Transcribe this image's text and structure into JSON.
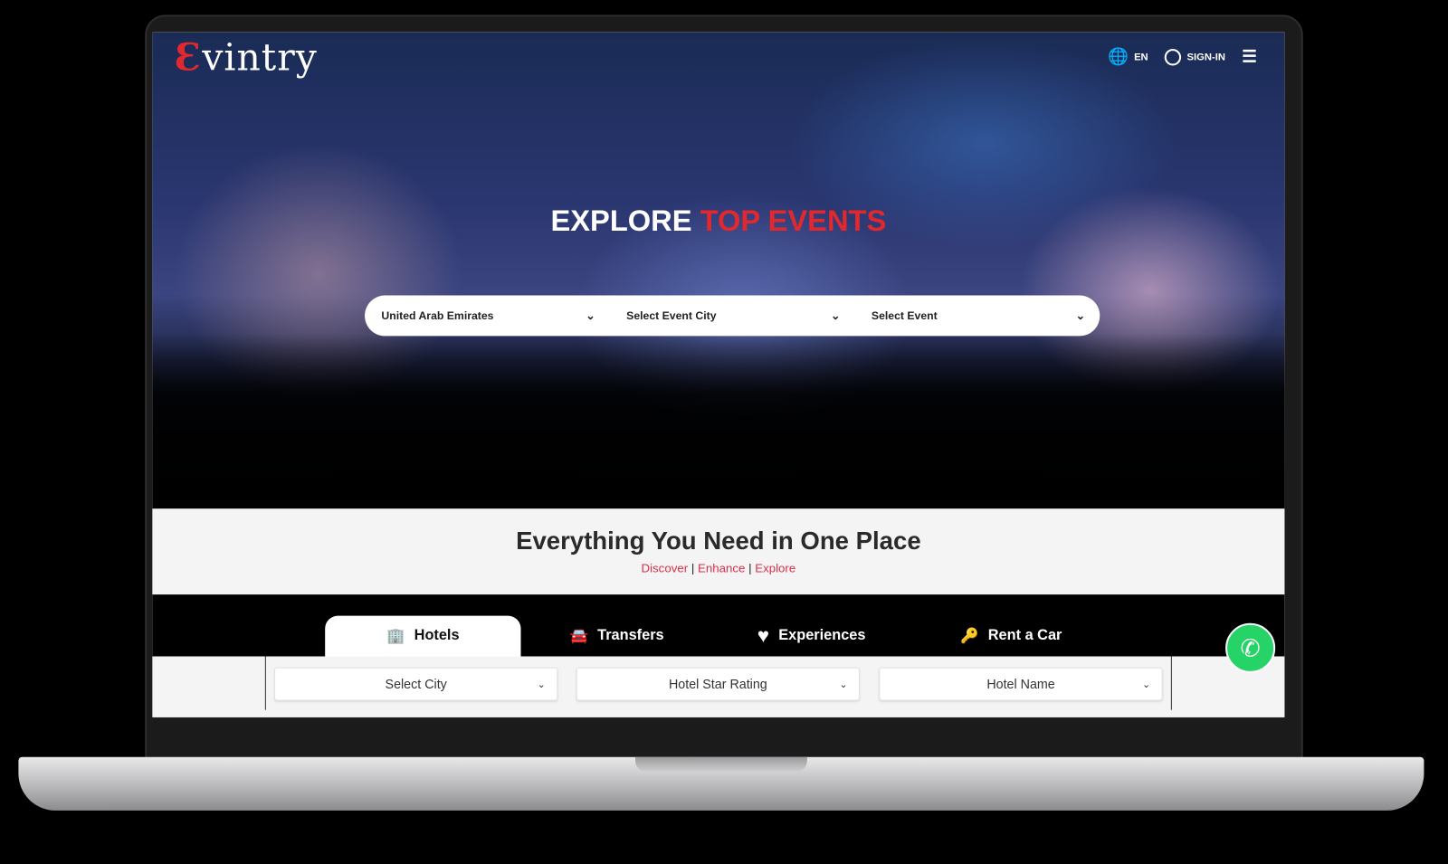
{
  "header": {
    "logo": "Evintry",
    "language": "EN",
    "sign_in": "SIGN-IN"
  },
  "hero": {
    "title_white": "EXPLORE",
    "title_red": "TOP EVENTS",
    "search": [
      {
        "value": "United Arab Emirates"
      },
      {
        "value": "Select Event City"
      },
      {
        "value": "Select Event"
      }
    ]
  },
  "section": {
    "title": "Everything You Need in One Place",
    "tagline": [
      "Discover",
      "Enhance",
      "Explore"
    ],
    "separator": "|"
  },
  "tabs": [
    {
      "label": "Hotels",
      "icon": "building-icon"
    },
    {
      "label": "Transfers",
      "icon": "car-icon"
    },
    {
      "label": "Experiences",
      "icon": "heart-icon"
    },
    {
      "label": "Rent a Car",
      "icon": "key-icon"
    }
  ],
  "hotel_form": {
    "city": "Select City",
    "rating": "Hotel Star Rating",
    "name": "Hotel Name"
  },
  "colors": {
    "accent": "#e0282e",
    "whatsapp": "#25d366"
  }
}
